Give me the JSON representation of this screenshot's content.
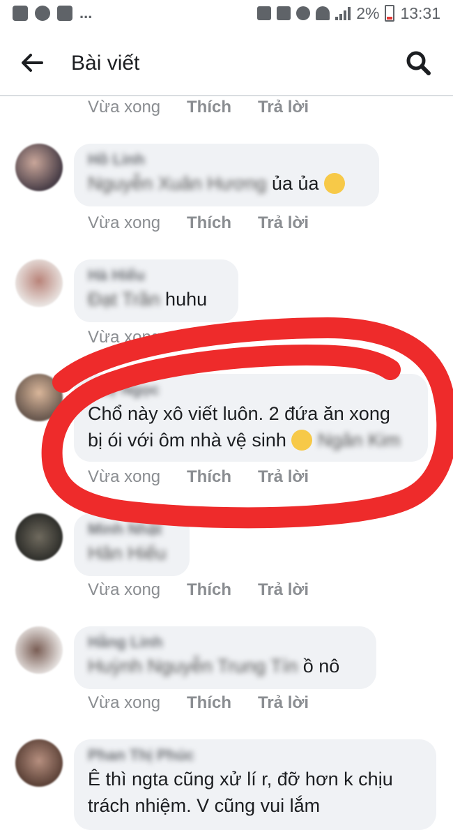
{
  "status_bar": {
    "battery": "2%",
    "time": "13:31",
    "dots": "..."
  },
  "app_bar": {
    "title": "Bài viết"
  },
  "labels": {
    "time": "Vừa xong",
    "like": "Thích",
    "reply": "Trả lời"
  },
  "comments": [
    {
      "name": "Hồ Linh",
      "mention": "Nguyễn Xuân Hương",
      "text": " ủa ủa",
      "emoji": "smile"
    },
    {
      "name": "Hà Hiếu",
      "mention": "Đạt Trần",
      "text": " huhu"
    },
    {
      "name": "Huệ Ngọc",
      "line1": "Chổ này xô viết luôn. 2 đứa ăn xong",
      "line2": "bị ói với ôm nhà vệ sinh",
      "mention": "Ngân Kim",
      "emoji": "cry"
    },
    {
      "name": "Minh Nhật",
      "mention": "Hân Hiếu"
    },
    {
      "name": "Hằng Linh",
      "mention": "Huỳnh Nguyễn Trung Tín",
      "text": " ồ nô"
    },
    {
      "name": "Phan Thị Phúc",
      "line1": "Ê thì ngta cũng xử lí r, đỡ hơn k chịu",
      "line2": "trách nhiệm. V cũng vui lắm"
    }
  ]
}
